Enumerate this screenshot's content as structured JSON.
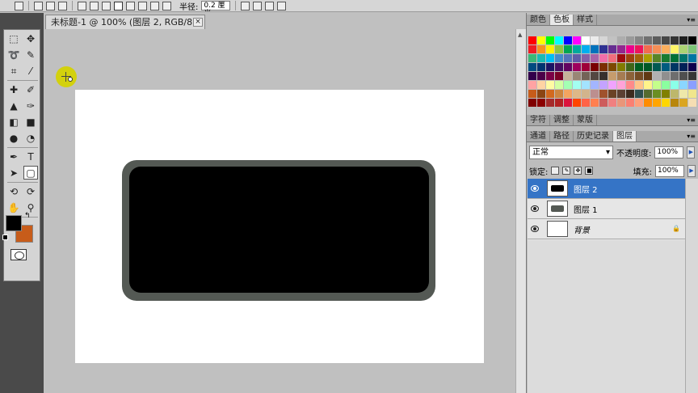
{
  "options_bar": {
    "radius_label": "半径:",
    "radius_value": "0.2 厘米"
  },
  "document": {
    "tab_title": "未标题-1 @ 100% (图层 2, RGB/8) *",
    "close_label": "×"
  },
  "colors": {
    "foreground": "#000000",
    "background": "#c75c1a",
    "shape_outer": "#545954",
    "shape_inner": "#000000",
    "cursor": "#d3d10d"
  },
  "toolbox": {
    "tools": [
      "marquee-icon",
      "move-icon",
      "lasso-icon",
      "quick-select-icon",
      "crop-icon",
      "eyedropper-icon",
      "healing-brush-icon",
      "brush-icon",
      "clone-stamp-icon",
      "history-brush-icon",
      "eraser-icon",
      "gradient-icon",
      "blur-icon",
      "dodge-icon",
      "pen-icon",
      "type-icon",
      "path-select-icon",
      "rounded-rect-icon",
      "3d-rotate-icon",
      "3d-orbit-icon",
      "hand-icon",
      "zoom-icon"
    ]
  },
  "swatches_panel": {
    "tabs": [
      "颜色",
      "色板",
      "样式"
    ],
    "active_tab": "色板"
  },
  "char_panel": {
    "tabs": [
      "字符",
      "调整",
      "蒙版"
    ]
  },
  "layers_panel": {
    "tabs": [
      "通道",
      "路径",
      "历史记录",
      "图层"
    ],
    "active_tab": "图层",
    "blend_mode": "正常",
    "opacity_label": "不透明度:",
    "opacity_value": "100%",
    "lock_label": "锁定:",
    "fill_label": "填充:",
    "fill_value": "100%",
    "layers": [
      {
        "name": "图层 2",
        "selected": true
      },
      {
        "name": "图层 1",
        "selected": false
      },
      {
        "name": "背景",
        "selected": false
      }
    ]
  }
}
